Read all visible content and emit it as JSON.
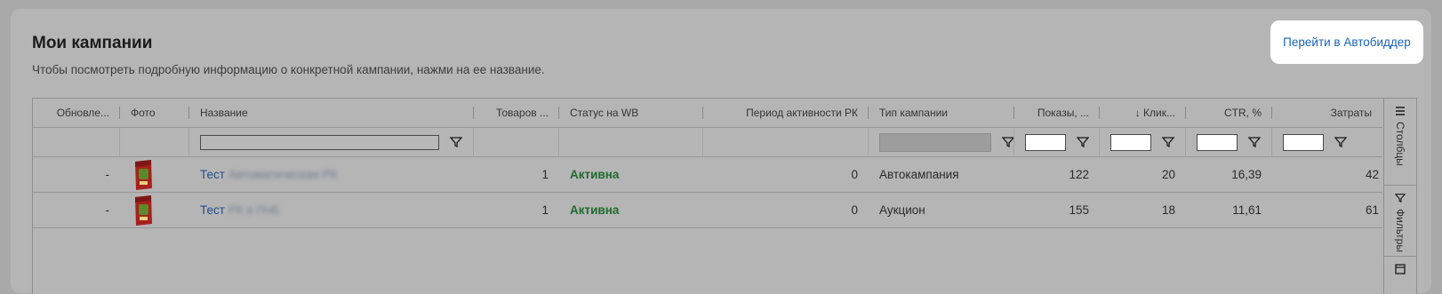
{
  "page": {
    "title": "Мои кампании",
    "subtitle": "Чтобы посмотреть подробную информацию о конкретной кампании, нажми на ее название.",
    "autobidder_button": "Перейти в Автобиддер"
  },
  "table": {
    "columns": {
      "updated": "Обновле...",
      "photo": "Фото",
      "name": "Название",
      "goods": "Товаров ...",
      "status": "Статус на WB",
      "period": "Период активности РК",
      "type": "Тип кампании",
      "shows": "Показы, ...",
      "clicks": "↓ Клик...",
      "ctr": "CTR, %",
      "cost": "Затраты"
    },
    "rows": [
      {
        "updated": "-",
        "name_visible": "Тест",
        "name_blurred": "Автоматическая РК",
        "goods": "1",
        "status": "Активна",
        "period": "0",
        "type": "Автокампания",
        "shows": "122",
        "clicks": "20",
        "ctr": "16,39",
        "cost": "42"
      },
      {
        "updated": "-",
        "name_visible": "Тест",
        "name_blurred": "РК в ПчБ",
        "goods": "1",
        "status": "Активна",
        "period": "0",
        "type": "Аукцион",
        "shows": "155",
        "clicks": "18",
        "ctr": "11,61",
        "cost": "61"
      }
    ]
  },
  "side_panel": {
    "columns_label": "Столбцы",
    "filters_label": "Фильтры"
  },
  "icons": {
    "filter": "filter-funnel-icon",
    "columns": "columns-menu-icon",
    "thumbnail": "product-thumbnail"
  },
  "colors": {
    "link": "#1f4f88",
    "active_status": "#1e6b2e",
    "button_text": "#1a63b8"
  }
}
